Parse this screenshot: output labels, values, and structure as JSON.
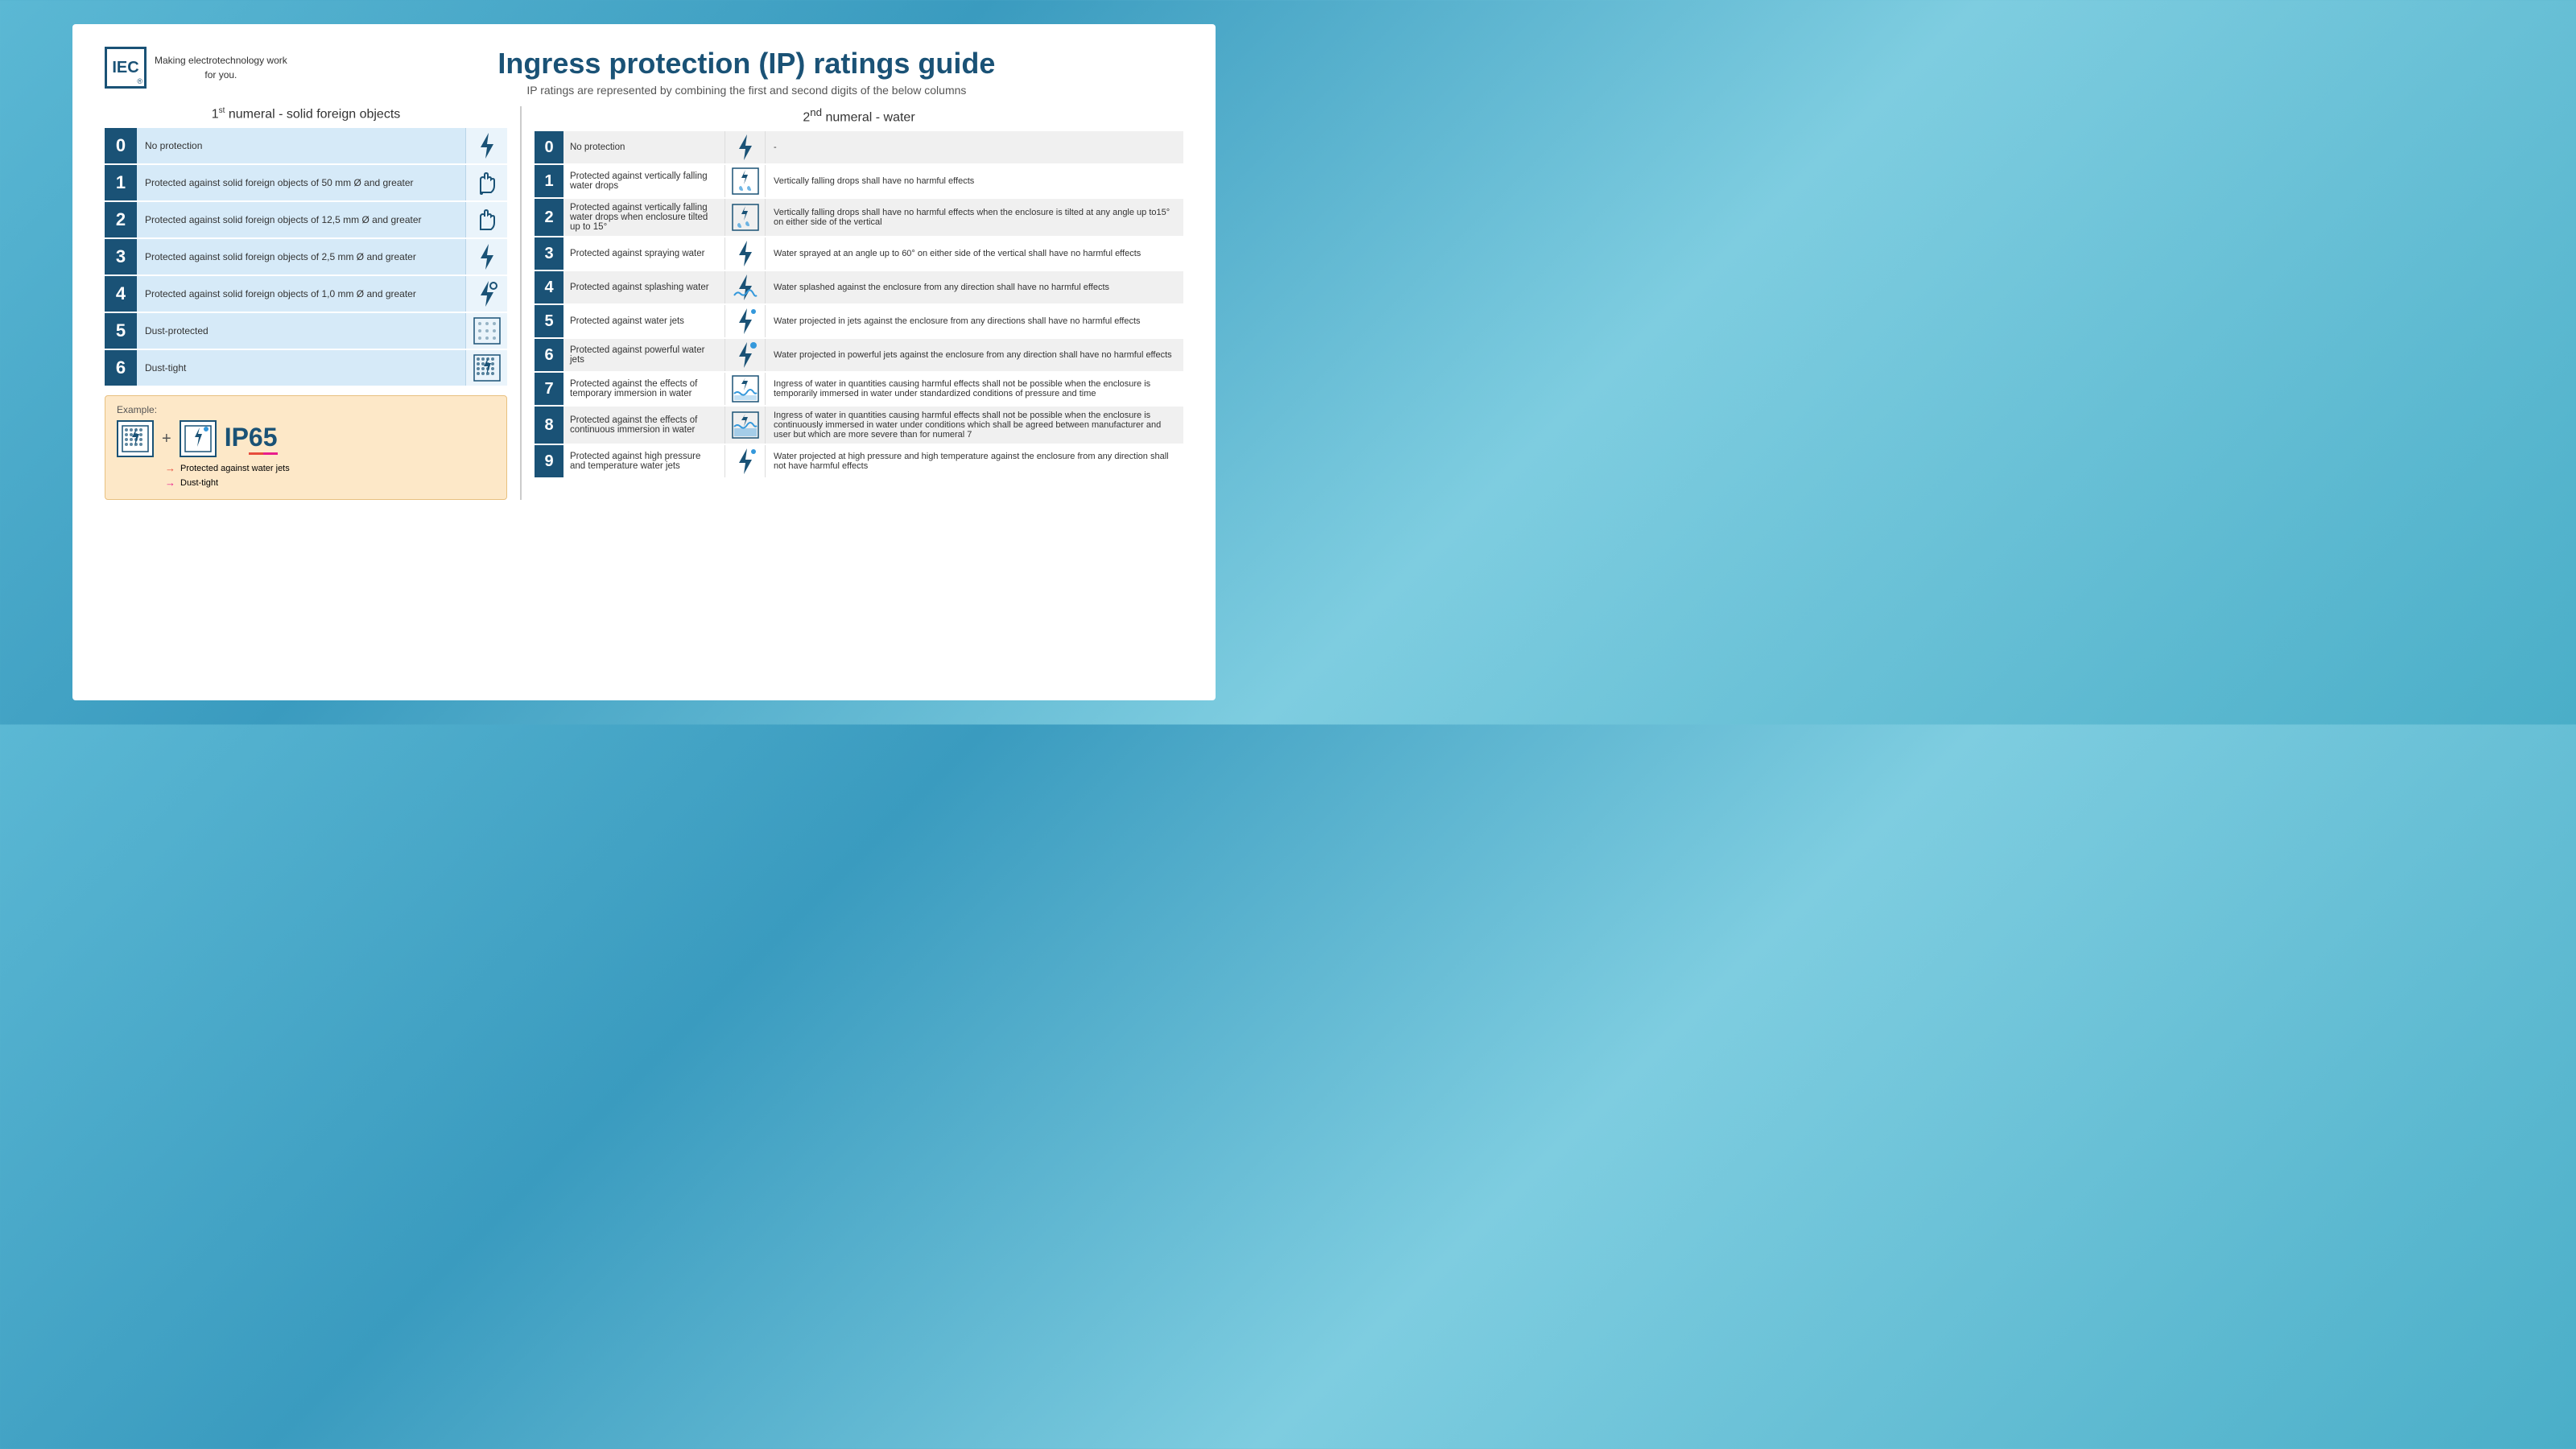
{
  "page": {
    "title": "Ingress protection (IP) ratings guide",
    "subtitle": "IP ratings are represented by combining the first and second digits of the below columns"
  },
  "iec": {
    "name": "IEC",
    "reg": "®",
    "tagline": "Making  electrotechnology work\n for you."
  },
  "left_col": {
    "header": "1st numeral - solid foreign objects",
    "rows": [
      {
        "num": "0",
        "desc": "No protection",
        "icon": "bolt"
      },
      {
        "num": "1",
        "desc": "Protected against solid foreign objects of 50 mm Ø and greater",
        "icon": "hand-large"
      },
      {
        "num": "2",
        "desc": "Protected against solid foreign objects of 12,5 mm Ø and greater",
        "icon": "hand-small"
      },
      {
        "num": "3",
        "desc": "Protected against solid foreign objects of 2,5 mm Ø and greater",
        "icon": "screwdriver"
      },
      {
        "num": "4",
        "desc": "Protected against solid foreign objects of 1,0 mm Ø and greater",
        "icon": "wire"
      },
      {
        "num": "5",
        "desc": "Dust-protected",
        "icon": "dots-sparse"
      },
      {
        "num": "6",
        "desc": "Dust-tight",
        "icon": "dots-dense"
      }
    ]
  },
  "example": {
    "label": "Example:",
    "ip_prefix": "IP",
    "ip_digit1": "6",
    "ip_digit2": "5",
    "ann1": "Protected against water jets",
    "ann2": "Dust-tight"
  },
  "right_col": {
    "header": "2nd numeral - water",
    "rows": [
      {
        "num": "0",
        "desc": "No protection",
        "icon": "bolt",
        "detail": "-"
      },
      {
        "num": "1",
        "desc": "Protected against vertically falling water drops",
        "icon": "drops-v",
        "detail": "Vertically falling drops shall have no harmful effects"
      },
      {
        "num": "2",
        "desc": "Protected against vertically falling water drops when enclosure tilted up to 15°",
        "icon": "drops-v-tilt",
        "detail": "Vertically falling drops shall have no harmful effects when the enclosure is tilted at any angle up to15° on either side of the vertical"
      },
      {
        "num": "3",
        "desc": "Protected against spraying water",
        "icon": "bolt",
        "detail": "Water sprayed at an angle up to 60° on either side of the vertical shall have no harmful effects"
      },
      {
        "num": "4",
        "desc": "Protected against splashing water",
        "icon": "splash",
        "detail": "Water splashed against the enclosure from any direction shall have no harmful effects"
      },
      {
        "num": "5",
        "desc": "Protected against water jets",
        "icon": "bolt-dot",
        "detail": "Water projected in jets against the enclosure from any directions shall have no harmful effects"
      },
      {
        "num": "6",
        "desc": "Protected against powerful water jets",
        "icon": "bolt-dot-blue",
        "detail": "Water projected in powerful jets against the enclosure from any direction shall have no harmful effects"
      },
      {
        "num": "7",
        "desc": "Protected against the effects of temporary immersion in water",
        "icon": "wave",
        "detail": "Ingress of water in quantities causing harmful effects shall not be possible when the enclosure is temporarily immersed in water under standardized conditions of pressure and time"
      },
      {
        "num": "8",
        "desc": "Protected against the effects of continuous immersion in water",
        "icon": "wave-deep",
        "detail": "Ingress of water in quantities causing harmful effects shall not be possible when the enclosure is continuously immersed in water under conditions which shall be agreed between manufacturer and user but which are more severe than for numeral 7"
      },
      {
        "num": "9",
        "desc": "Protected against high pressure and temperature water jets",
        "icon": "bolt-dot",
        "detail": "Water projected at high pressure and high temperature against the enclosure from any direction shall not have harmful effects"
      }
    ]
  }
}
